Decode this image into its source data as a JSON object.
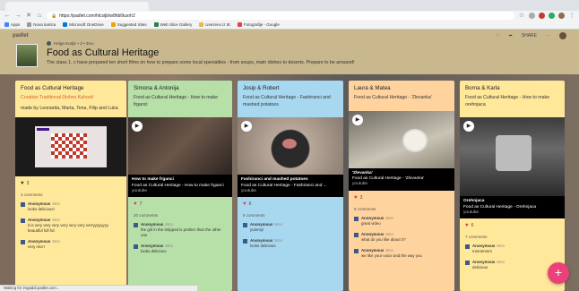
{
  "browser": {
    "url": "https://padlet.com/hlcsijb/w8hbl9uxrh2",
    "bookmarks": [
      "Apps",
      "Nova kartica",
      "Microsoft OneDrive",
      "Suggested Sites",
      "Web Slice Gallery",
      "Uvezeno iz IE",
      "Fotografije - Google"
    ]
  },
  "padlet": {
    "logo": "padlet",
    "author_meta": "Helga Kraljic • 2 • 3mo",
    "title": "Food as Cultural Heritage",
    "description": "The class 1. c have prepared ten short films on how to prepare some local specialties - from soups, main dishes to deserts. Prepare to be amazed!",
    "share": "SHARE",
    "drag_handle": "⋮⋮"
  },
  "columns": [
    {
      "title": "Food as Cultural Heritage",
      "subtitle": "Croatian Traditional Dishes Kahoot!",
      "body": "made by Leonarda, Marta, Tena, Filip and Luka",
      "likes": "3",
      "comments_count": "3 comments",
      "comments": [
        {
          "name": "Anonymous",
          "time": "8mo",
          "text": "looks delicious!"
        },
        {
          "name": "Anonymous",
          "time": "8mo",
          "text": "it is very very very very very very verryyyyyyyy beautiful full hd"
        },
        {
          "name": "Anonymous",
          "time": "8mo",
          "text": "very nice!"
        }
      ]
    },
    {
      "title": "Simona & Antonija",
      "body": "Food as Cultural Heritage - How to make frganci",
      "cap_title": "How to make frganci",
      "cap_sub": "Food as Cultural Heritage - How to make frganci",
      "cap_src": "youtube",
      "likes": "7",
      "comments_count": "20 comments",
      "comments": [
        {
          "name": "Anonymous",
          "time": "8mo",
          "text": "the girl in the stripped is prettier than the other one"
        },
        {
          "name": "Anonymous",
          "time": "8mo",
          "text": "looks delicious"
        }
      ]
    },
    {
      "title": "Josip & Robert",
      "body": "Food as Cultural Heritage - Fashiranci and mashed potatoes",
      "cap_title": "Fashiranci and mashed potatoes",
      "cap_sub": "Food as Cultural Heritage - Fashiranci and ...",
      "cap_src": "youtube",
      "likes": "6",
      "comments_count": "6 comments",
      "comments": [
        {
          "name": "Anonymous",
          "time": "8mo",
          "text": "yummy!"
        },
        {
          "name": "Anonymous",
          "time": "8mo",
          "text": "looks delicious"
        }
      ]
    },
    {
      "title": "Laura & Matea",
      "body": "Food as Cultural Heritage - 'Zlevanka'",
      "cap_title": "'Zlevanka'",
      "cap_sub": "Food as Cultural Heritage - 'Zlevanka'",
      "cap_src": "youtube",
      "likes": "3",
      "comments_count": "8 comments",
      "comments": [
        {
          "name": "Anonymous",
          "time": "8mo",
          "text": "great video"
        },
        {
          "name": "Anonymous",
          "time": "8mo",
          "text": "what do you like about it?"
        },
        {
          "name": "Anonymous",
          "time": "8mo",
          "text": "we like your voice and the way you"
        }
      ]
    },
    {
      "title": "Borna & Karla",
      "body": "Food as Cultural Heritage - How to make orehnjaca",
      "cap_title": "Orehnjaca",
      "cap_sub": "Food as Cultural Heritage - Orehnjaca",
      "cap_src": "youtube",
      "likes": "6",
      "comments_count": "7 comments",
      "comments": [
        {
          "name": "Anonymous",
          "time": "8mo",
          "text": "mmmmmm"
        },
        {
          "name": "Anonymous",
          "time": "8mo",
          "text": "delicious"
        }
      ]
    }
  ],
  "status": "Waiting for imgaddi.padlet.com...",
  "fab": "+"
}
